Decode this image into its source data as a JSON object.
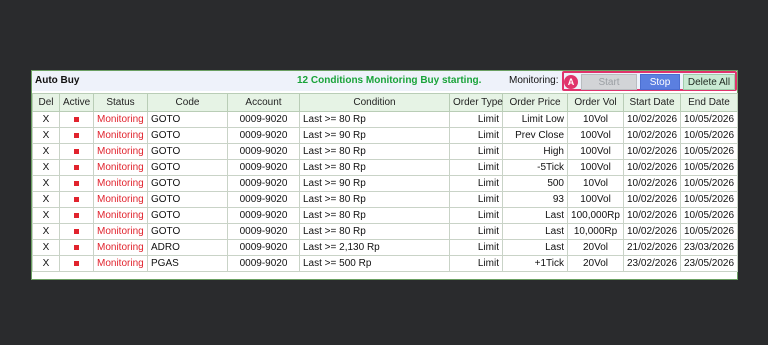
{
  "panel": {
    "title": "Auto Buy",
    "banner": "12 Conditions Monitoring Buy starting.",
    "monitoring_label": "Monitoring:",
    "badge": "A",
    "buttons": {
      "start": "Start",
      "stop": "Stop",
      "delete_all": "Delete All"
    }
  },
  "colors": {
    "banner": "#1aa33a",
    "status": "#e1232d",
    "badge": "#e0336b",
    "stop_button": "#5b7fe0",
    "delete_button": "#c9ead3",
    "header": "#e6f3e5"
  },
  "columns": [
    "Del",
    "Active",
    "Status",
    "Code",
    "Account",
    "Condition",
    "Order Type",
    "Order Price",
    "Order Vol",
    "Start Date",
    "End Date"
  ],
  "rows": [
    {
      "del": "X",
      "status": "Monitoring",
      "code": "GOTO",
      "account": "0009-9020",
      "condition": "Last >= 80 Rp",
      "order_type": "Limit",
      "order_price": "Limit Low",
      "order_vol": "10Vol",
      "start_date": "10/02/2026",
      "end_date": "10/05/2026"
    },
    {
      "del": "X",
      "status": "Monitoring",
      "code": "GOTO",
      "account": "0009-9020",
      "condition": "Last >= 90 Rp",
      "order_type": "Limit",
      "order_price": "Prev Close",
      "order_vol": "100Vol",
      "start_date": "10/02/2026",
      "end_date": "10/05/2026"
    },
    {
      "del": "X",
      "status": "Monitoring",
      "code": "GOTO",
      "account": "0009-9020",
      "condition": "Last >= 80 Rp",
      "order_type": "Limit",
      "order_price": "High",
      "order_vol": "100Vol",
      "start_date": "10/02/2026",
      "end_date": "10/05/2026"
    },
    {
      "del": "X",
      "status": "Monitoring",
      "code": "GOTO",
      "account": "0009-9020",
      "condition": "Last >= 80 Rp",
      "order_type": "Limit",
      "order_price": "-5Tick",
      "order_vol": "100Vol",
      "start_date": "10/02/2026",
      "end_date": "10/05/2026"
    },
    {
      "del": "X",
      "status": "Monitoring",
      "code": "GOTO",
      "account": "0009-9020",
      "condition": "Last >= 90 Rp",
      "order_type": "Limit",
      "order_price": "500",
      "order_vol": "10Vol",
      "start_date": "10/02/2026",
      "end_date": "10/05/2026"
    },
    {
      "del": "X",
      "status": "Monitoring",
      "code": "GOTO",
      "account": "0009-9020",
      "condition": "Last >= 80 Rp",
      "order_type": "Limit",
      "order_price": "93",
      "order_vol": "100Vol",
      "start_date": "10/02/2026",
      "end_date": "10/05/2026"
    },
    {
      "del": "X",
      "status": "Monitoring",
      "code": "GOTO",
      "account": "0009-9020",
      "condition": "Last >= 80 Rp",
      "order_type": "Limit",
      "order_price": "Last",
      "order_vol": "100,000Rp",
      "start_date": "10/02/2026",
      "end_date": "10/05/2026"
    },
    {
      "del": "X",
      "status": "Monitoring",
      "code": "GOTO",
      "account": "0009-9020",
      "condition": "Last >= 80 Rp",
      "order_type": "Limit",
      "order_price": "Last",
      "order_vol": "10,000Rp",
      "start_date": "10/02/2026",
      "end_date": "10/05/2026"
    },
    {
      "del": "X",
      "status": "Monitoring",
      "code": "ADRO",
      "account": "0009-9020",
      "condition": "Last >= 2,130 Rp",
      "order_type": "Limit",
      "order_price": "Last",
      "order_vol": "20Vol",
      "start_date": "21/02/2026",
      "end_date": "23/03/2026"
    },
    {
      "del": "X",
      "status": "Monitoring",
      "code": "PGAS",
      "account": "0009-9020",
      "condition": "Last >= 500 Rp",
      "order_type": "Limit",
      "order_price": "+1Tick",
      "order_vol": "20Vol",
      "start_date": "23/02/2026",
      "end_date": "23/05/2026"
    }
  ]
}
